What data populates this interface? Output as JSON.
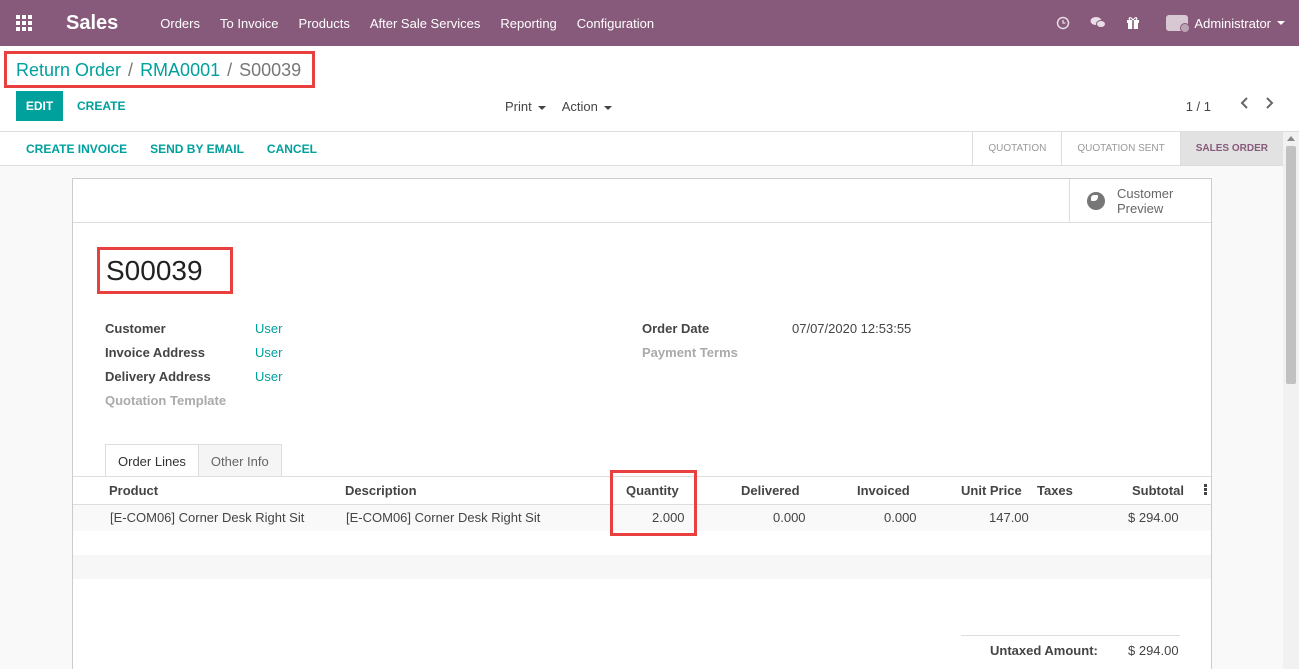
{
  "navbar": {
    "brand": "Sales",
    "menu": [
      "Orders",
      "To Invoice",
      "Products",
      "After Sale Services",
      "Reporting",
      "Configuration"
    ],
    "user": "Administrator"
  },
  "breadcrumb": {
    "first": "Return Order",
    "second": "RMA0001",
    "current": "S00039"
  },
  "controls": {
    "edit": "EDIT",
    "create": "CREATE",
    "print": "Print",
    "action": "Action",
    "pager": "1 / 1"
  },
  "statusbar": {
    "buttons": [
      "CREATE INVOICE",
      "SEND BY EMAIL",
      "CANCEL"
    ],
    "stages": [
      "QUOTATION",
      "QUOTATION SENT",
      "SALES ORDER"
    ],
    "current_stage": "SALES ORDER"
  },
  "sheet": {
    "preview_line1": "Customer",
    "preview_line2": "Preview",
    "order_name": "S00039",
    "fields_left": [
      {
        "label": "Customer",
        "value": "User"
      },
      {
        "label": "Invoice Address",
        "value": "User"
      },
      {
        "label": "Delivery Address",
        "value": "User"
      },
      {
        "label": "Quotation Template",
        "value": ""
      }
    ],
    "fields_right": [
      {
        "label": "Order Date",
        "value": "07/07/2020 12:53:55"
      },
      {
        "label": "Payment Terms",
        "value": ""
      }
    ],
    "tabs": [
      "Order Lines",
      "Other Info"
    ],
    "table": {
      "headers": [
        "Product",
        "Description",
        "Quantity",
        "Delivered",
        "Invoiced",
        "Unit Price",
        "Taxes",
        "Subtotal"
      ],
      "rows": [
        [
          "[E-COM06] Corner Desk Right Sit",
          "[E-COM06] Corner Desk Right Sit",
          "2.000",
          "0.000",
          "0.000",
          "147.00",
          "",
          "$ 294.00"
        ]
      ]
    },
    "totals": {
      "untaxed_label": "Untaxed Amount:",
      "untaxed_value": "$ 294.00"
    }
  },
  "colors": {
    "navbar": "#875a7b",
    "accent": "#00a09d",
    "highlight": "#e8403f"
  }
}
